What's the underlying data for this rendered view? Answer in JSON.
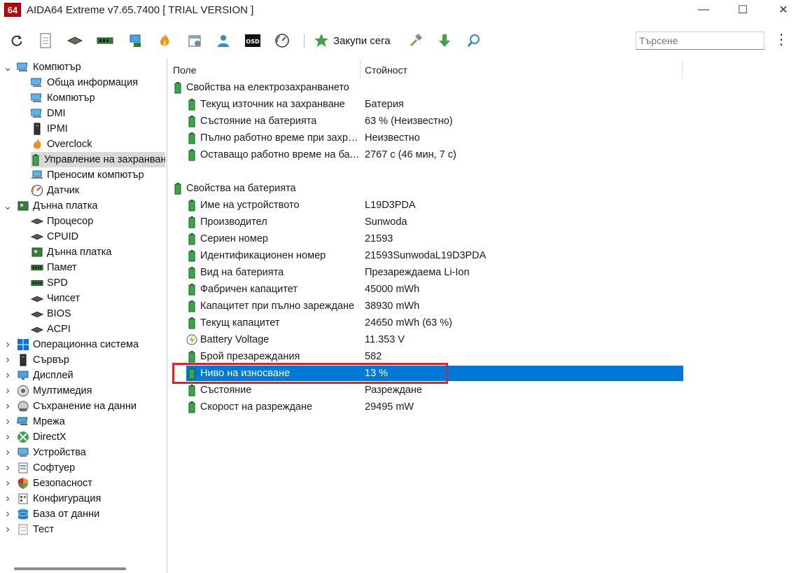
{
  "window": {
    "logo": "64",
    "title": "AIDA64 Extreme v7.65.7400  [ TRIAL VERSION ]",
    "minimize": "—",
    "maximize": "☐",
    "close": "✕"
  },
  "toolbar": {
    "buy_label": "Закупи сега",
    "search_placeholder": "Търсене",
    "more": "⋮"
  },
  "tree": [
    {
      "label": "Компютър",
      "level": 0,
      "expanded": true,
      "icon": "computer-icon"
    },
    {
      "label": "Обща информация",
      "level": 1,
      "icon": "computer-icon"
    },
    {
      "label": "Компютър",
      "level": 1,
      "icon": "computer-icon"
    },
    {
      "label": "DMI",
      "level": 1,
      "icon": "computer-icon"
    },
    {
      "label": "IPMI",
      "level": 1,
      "icon": "server-icon"
    },
    {
      "label": "Overclock",
      "level": 1,
      "icon": "fire-icon"
    },
    {
      "label": "Управление на захранването",
      "level": 1,
      "icon": "battery-icon",
      "selected": true
    },
    {
      "label": "Преносим компютър",
      "level": 1,
      "icon": "laptop-icon"
    },
    {
      "label": "Датчик",
      "level": 1,
      "icon": "gauge-icon"
    },
    {
      "label": "Дънна платка",
      "level": 0,
      "expanded": true,
      "icon": "motherboard-icon"
    },
    {
      "label": "Процесор",
      "level": 1,
      "icon": "cpu-icon"
    },
    {
      "label": "CPUID",
      "level": 1,
      "icon": "cpu-icon"
    },
    {
      "label": "Дънна платка",
      "level": 1,
      "icon": "motherboard-icon"
    },
    {
      "label": "Памет",
      "level": 1,
      "icon": "ram-icon"
    },
    {
      "label": "SPD",
      "level": 1,
      "icon": "ram-icon"
    },
    {
      "label": "Чипсет",
      "level": 1,
      "icon": "chip-icon"
    },
    {
      "label": "BIOS",
      "level": 1,
      "icon": "chip-icon"
    },
    {
      "label": "ACPI",
      "level": 1,
      "icon": "chip-icon"
    },
    {
      "label": "Операционна система",
      "level": 0,
      "icon": "windows-icon"
    },
    {
      "label": "Сървър",
      "level": 0,
      "icon": "server-icon"
    },
    {
      "label": "Дисплей",
      "level": 0,
      "icon": "monitor-icon"
    },
    {
      "label": "Мултимедия",
      "level": 0,
      "icon": "speaker-icon"
    },
    {
      "label": "Съхранение на данни",
      "level": 0,
      "icon": "disk-icon"
    },
    {
      "label": "Мрежа",
      "level": 0,
      "icon": "network-icon"
    },
    {
      "label": "DirectX",
      "level": 0,
      "icon": "xbox-icon"
    },
    {
      "label": "Устройства",
      "level": 0,
      "icon": "devices-icon"
    },
    {
      "label": "Софтуер",
      "level": 0,
      "icon": "software-icon"
    },
    {
      "label": "Безопасност",
      "level": 0,
      "icon": "shield-icon"
    },
    {
      "label": "Конфигурация",
      "level": 0,
      "icon": "config-icon"
    },
    {
      "label": "База от данни",
      "level": 0,
      "icon": "database-icon"
    },
    {
      "label": "Тест",
      "level": 0,
      "icon": "test-icon"
    }
  ],
  "list": {
    "col_field": "Поле",
    "col_value": "Стойност",
    "rows": [
      {
        "type": "group",
        "field": "Свойства на електрозахранването",
        "value": ""
      },
      {
        "type": "item",
        "field": "Текущ източник на захранване",
        "value": "Батерия"
      },
      {
        "type": "item",
        "field": "Състояние на батерията",
        "value": "63 % (Неизвестно)"
      },
      {
        "type": "item",
        "field": "Пълно работно време при захранване от батерията",
        "value": "Неизвестно"
      },
      {
        "type": "item",
        "field": "Оставащо работно време на батерията",
        "value": "2767 с (46 мин, 7 с)"
      },
      {
        "type": "blank",
        "field": "",
        "value": ""
      },
      {
        "type": "group",
        "field": "Свойства на батерията",
        "value": ""
      },
      {
        "type": "item",
        "field": "Име на устройството",
        "value": "L19D3PDA"
      },
      {
        "type": "item",
        "field": "Производител",
        "value": "Sunwoda"
      },
      {
        "type": "item",
        "field": "Сериен номер",
        "value": "21593"
      },
      {
        "type": "item",
        "field": "Идентификационен номер",
        "value": "21593SunwodaL19D3PDA"
      },
      {
        "type": "item",
        "field": "Вид на батерията",
        "value": "Презареждаема Li-Ion"
      },
      {
        "type": "item",
        "field": "Фабричен капацитет",
        "value": "45000 mWh"
      },
      {
        "type": "item",
        "field": "Капацитет при пълно зареждане",
        "value": "38930 mWh"
      },
      {
        "type": "item",
        "field": "Текущ капацитет",
        "value": "24650 mWh  (63 %)"
      },
      {
        "type": "item",
        "field": "Battery Voltage",
        "value": "11.353 V",
        "icon": "voltage-icon"
      },
      {
        "type": "item",
        "field": "Брой презареждания",
        "value": "582"
      },
      {
        "type": "item",
        "field": "Ниво на износване",
        "value": "13 %",
        "selected": true
      },
      {
        "type": "item",
        "field": "Състояние",
        "value": "Разреждане"
      },
      {
        "type": "item",
        "field": "Скорост на разреждане",
        "value": "29495 mW"
      }
    ]
  },
  "colors": {
    "selection": "#0078d7",
    "highlight_border": "#d9232d",
    "tree_selected": "#d9d9d9"
  }
}
